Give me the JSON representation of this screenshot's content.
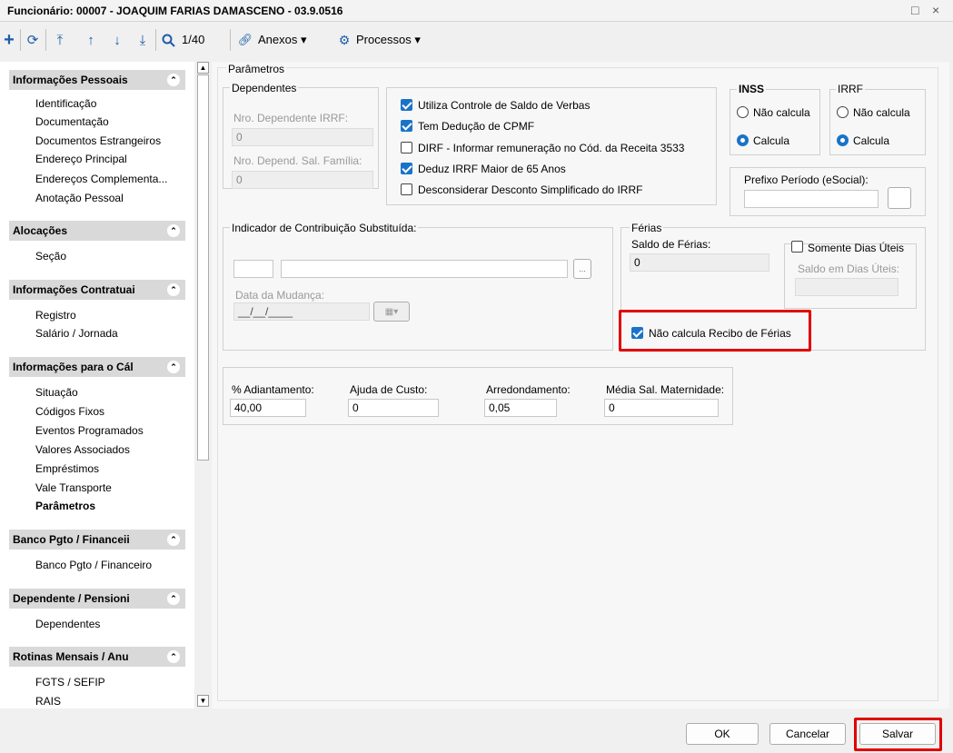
{
  "window": {
    "title": "Funcionário: 00007 - JOAQUIM FARIAS DAMASCENO - 03.9.0516",
    "controls": [
      "□",
      "×"
    ]
  },
  "toolbar": {
    "record_counter": "1/40",
    "anexos_label": "Anexos",
    "processos_label": "Processos"
  },
  "sidebar": {
    "sections": [
      {
        "title": "Informações Pessoais",
        "items": [
          "Identificação",
          "Documentação",
          "Documentos Estrangeiros",
          "Endereço Principal",
          "Endereços Complementa...",
          "Anotação Pessoal"
        ]
      },
      {
        "title": "Alocações",
        "items": [
          "Seção"
        ]
      },
      {
        "title": "Informações Contratuai",
        "items": [
          "Registro",
          "Salário / Jornada"
        ]
      },
      {
        "title": "Informações para o Cál",
        "items": [
          "Situação",
          "Códigos Fixos",
          "Eventos Programados",
          "Valores Associados",
          "Empréstimos",
          "Vale Transporte",
          "Parâmetros"
        ]
      },
      {
        "title": "Banco Pgto / Financeii",
        "items": [
          "Banco Pgto / Financeiro"
        ]
      },
      {
        "title": "Dependente / Pensioni",
        "items": [
          "Dependentes"
        ]
      },
      {
        "title": "Rotinas Mensais / Anu",
        "items": [
          "FGTS / SEFIP",
          "RAIS"
        ]
      }
    ]
  },
  "parametros": {
    "title": "Parâmetros",
    "dependentes": {
      "title": "Dependentes",
      "irrf_label": "Nro. Dependente IRRF:",
      "irrf_value": "0",
      "salfam_label": "Nro. Depend. Sal. Família:",
      "salfam_value": "0"
    },
    "checks": [
      {
        "label": "Utiliza Controle de Saldo de Verbas",
        "checked": true
      },
      {
        "label": "Tem Dedução de CPMF",
        "checked": true
      },
      {
        "label": "DIRF - Informar remuneração no Cód. da Receita 3533",
        "checked": false
      },
      {
        "label": "Deduz IRRF Maior de 65 Anos",
        "checked": true
      },
      {
        "label": "Desconsiderar Desconto Simplificado do IRRF",
        "checked": false
      }
    ],
    "inss": {
      "title": "INSS",
      "opt1": "Não calcula",
      "opt2": "Calcula"
    },
    "irrf": {
      "title": "IRRF",
      "opt1": "Não calcula",
      "opt2": "Calcula"
    },
    "prefixo": {
      "label": "Prefixo Período (eSocial):",
      "value": ""
    },
    "indicador": {
      "title": "Indicador de Contribuição Substituída:",
      "code": "",
      "desc": "",
      "lookup": "...",
      "data_label": "Data da Mudança:",
      "data_value": "__/__/____"
    },
    "ferias": {
      "title": "Férias",
      "saldo_label": "Saldo de Férias:",
      "saldo_value": "0",
      "somente_label": "Somente Dias Úteis",
      "saldo_uteis_label": "Saldo em Dias Úteis:",
      "saldo_uteis_value": "",
      "nao_calcula_label": "Não calcula Recibo de Férias"
    },
    "valores": [
      {
        "label": "% Adiantamento:",
        "value": "40,00"
      },
      {
        "label": "Ajuda de Custo:",
        "value": "0"
      },
      {
        "label": "Arredondamento:",
        "value": "0,05"
      },
      {
        "label": "Média Sal. Maternidade:",
        "value": "0"
      }
    ]
  },
  "footer": {
    "ok": "OK",
    "cancel": "Cancelar",
    "save": "Salvar"
  },
  "colors": {
    "accent": "#1a73c8",
    "highlight": "#e10000"
  }
}
